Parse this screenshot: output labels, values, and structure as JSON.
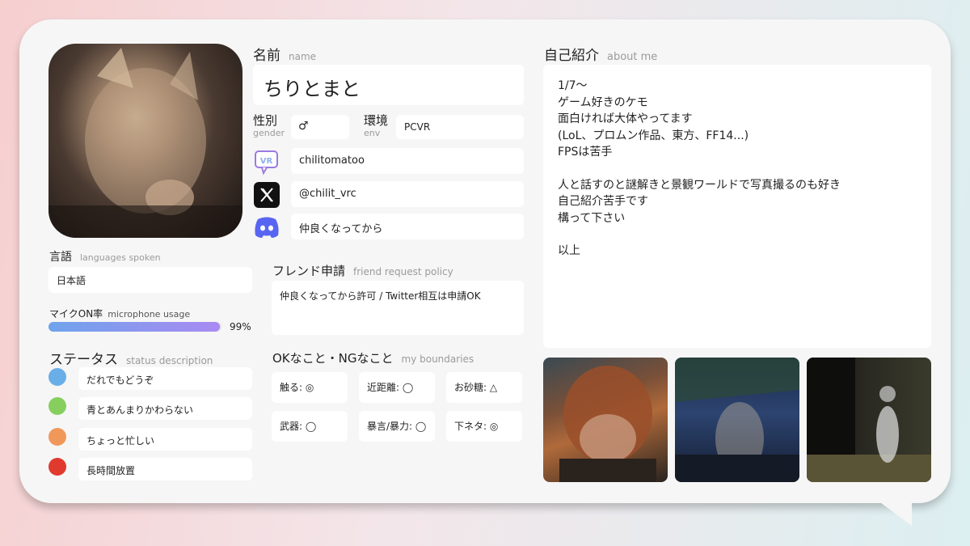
{
  "profile": {
    "name_label": "名前",
    "name_sublabel": "name",
    "name_value": "ちりとまと",
    "gender_label": "性別",
    "gender_sublabel": "gender",
    "gender_value": "♂",
    "env_label": "環境",
    "env_sublabel": "env",
    "env_value": "PCVR",
    "vrchat_id": "chilitomatoo",
    "twitter_handle": "@chilit_vrc",
    "discord_policy": "仲良くなってから"
  },
  "languages": {
    "label": "言語",
    "sublabel": "languages spoken",
    "value": "日本語"
  },
  "mic": {
    "label": "マイクON率",
    "sublabel": "microphone usage",
    "percent_text": "99%",
    "level": 0.99
  },
  "status": {
    "label": "ステータス",
    "sublabel": "status description",
    "items": [
      {
        "color": "#6aaee8",
        "text": "だれでもどうぞ"
      },
      {
        "color": "#86cf5e",
        "text": "青とあんまりかわらない"
      },
      {
        "color": "#f0985a",
        "text": "ちょっと忙しい"
      },
      {
        "color": "#e03a2e",
        "text": "長時間放置"
      }
    ]
  },
  "friend_request": {
    "label": "フレンド申請",
    "sublabel": "friend request policy",
    "value": "仲良くなってから許可 / Twitter相互は申請OK"
  },
  "boundaries": {
    "label": "OKなこと・NGなこと",
    "sublabel": "my boundaries",
    "items": [
      "触る: ◎",
      "近距離: ◯",
      "お砂糖: △",
      "武器: ◯",
      "暴言/暴力: ◯",
      "下ネタ: ◎"
    ]
  },
  "about": {
    "label": "自己紹介",
    "sublabel": "about me",
    "lines": [
      "1/7〜",
      "ゲーム好きのケモ",
      "面白ければ大体やってます",
      "(LoL、プロムン作品、東方、FF14...)",
      "FPSは苦手",
      "",
      "人と話すのと謎解きと景観ワールドで写真撮るのも好き",
      "自己紹介苦手です",
      "構って下さい",
      "",
      "以上"
    ]
  },
  "icons": {
    "vrchat": "vrchat-logo-icon",
    "twitter": "x-logo-icon",
    "discord": "discord-logo-icon"
  },
  "colors": {
    "mic_bar_start": "#6fa3ec",
    "mic_bar_end": "#a98af2",
    "discord": "#5865f2",
    "vrchat_purple": "#9b7be0"
  }
}
